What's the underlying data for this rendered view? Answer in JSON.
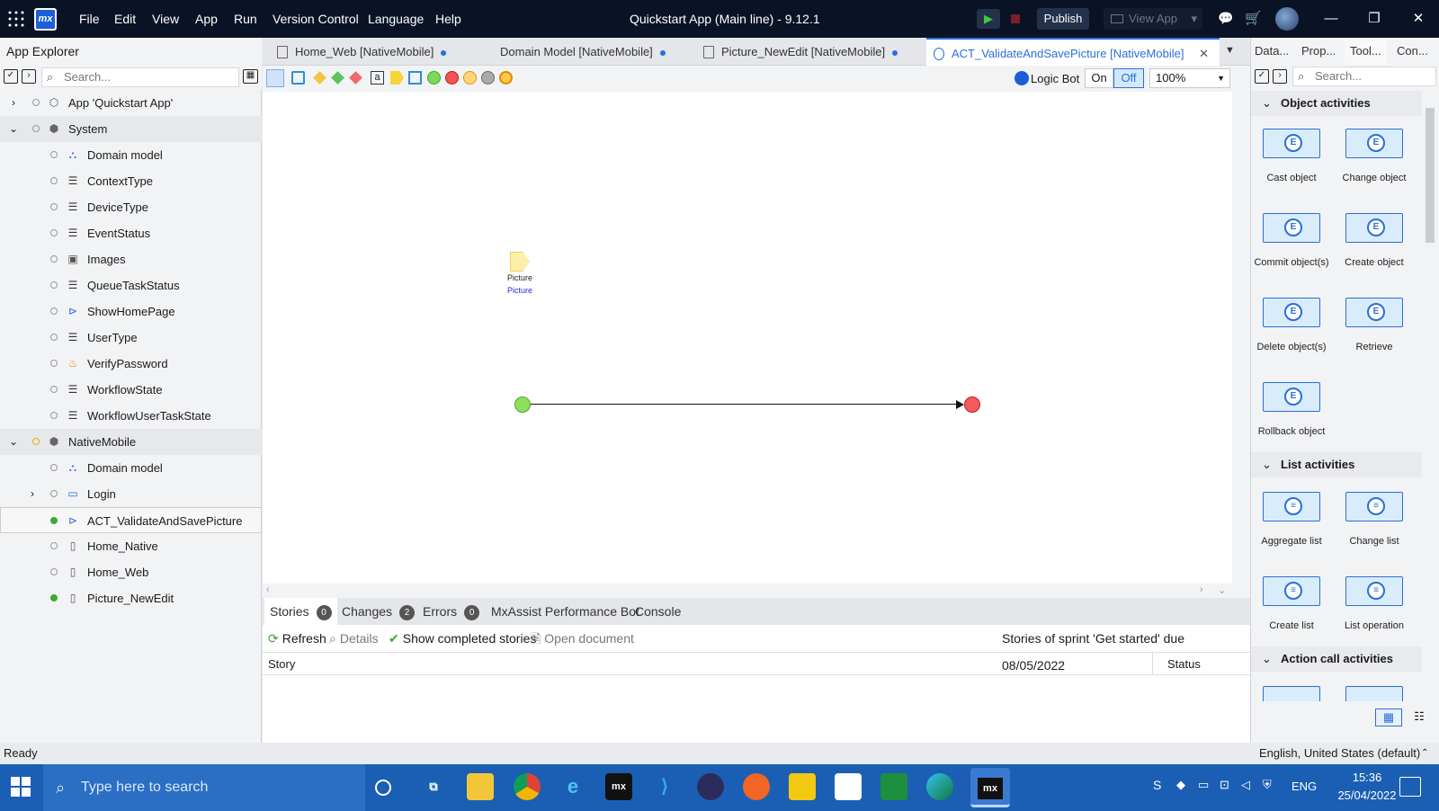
{
  "titlebar": {
    "logo_text": "mx",
    "menus": [
      "File",
      "Edit",
      "View",
      "App",
      "Run",
      "Version Control",
      "Language",
      "Help"
    ],
    "title": "Quickstart App (Main line)  -  9.12.1",
    "publish_label": "Publish",
    "view_app_label": "View App"
  },
  "explorer": {
    "title": "App Explorer",
    "search_placeholder": "Search...",
    "items": [
      {
        "label": "App 'Quickstart App'",
        "icon": "box-icon"
      },
      {
        "label": "System",
        "icon": "module-icon"
      },
      {
        "label": "Domain model",
        "icon": "domain-model-icon"
      },
      {
        "label": "ContextType",
        "icon": "enumeration-icon"
      },
      {
        "label": "DeviceType",
        "icon": "enumeration-icon"
      },
      {
        "label": "EventStatus",
        "icon": "enumeration-icon"
      },
      {
        "label": "Images",
        "icon": "image-collection-icon"
      },
      {
        "label": "QueueTaskStatus",
        "icon": "enumeration-icon"
      },
      {
        "label": "ShowHomePage",
        "icon": "microflow-icon"
      },
      {
        "label": "UserType",
        "icon": "enumeration-icon"
      },
      {
        "label": "VerifyPassword",
        "icon": "java-action-icon"
      },
      {
        "label": "WorkflowState",
        "icon": "enumeration-icon"
      },
      {
        "label": "WorkflowUserTaskState",
        "icon": "enumeration-icon"
      },
      {
        "label": "NativeMobile",
        "icon": "module-icon"
      },
      {
        "label": "Domain model",
        "icon": "domain-model-icon"
      },
      {
        "label": "Login",
        "icon": "folder-icon"
      },
      {
        "label": "ACT_ValidateAndSavePicture",
        "icon": "microflow-icon"
      },
      {
        "label": "Home_Native",
        "icon": "native-page-icon"
      },
      {
        "label": "Home_Web",
        "icon": "page-icon"
      },
      {
        "label": "Picture_NewEdit",
        "icon": "page-icon"
      }
    ]
  },
  "tabs": [
    {
      "label": "Home_Web [NativeMobile]"
    },
    {
      "label": "Domain Model [NativeMobile]"
    },
    {
      "label": "Picture_NewEdit [NativeMobile]"
    },
    {
      "label": "ACT_ValidateAndSavePicture [NativeMobile]"
    }
  ],
  "toolstrip": {
    "logic_bot_label": "Logic Bot",
    "on_label": "On",
    "off_label": "Off",
    "zoom": "100%"
  },
  "canvas": {
    "parameter_name": "Picture",
    "parameter_type": "Picture"
  },
  "bottom": {
    "tabs": [
      {
        "label": "Stories",
        "count": "0"
      },
      {
        "label": "Changes",
        "count": "2"
      },
      {
        "label": "Errors",
        "count": "0"
      },
      {
        "label": "MxAssist Performance Bot",
        "count": ""
      },
      {
        "label": "Console",
        "count": ""
      }
    ],
    "refresh_label": "Refresh",
    "details_label": "Details",
    "show_completed_label": "Show completed stories",
    "open_document_label": "Open document",
    "sprint_text": "Stories of sprint 'Get started' due 08/05/2022",
    "col_story": "Story",
    "col_status": "Status"
  },
  "right": {
    "tabs": [
      "Data...",
      "Prop...",
      "Tool...",
      "Con..."
    ],
    "search_placeholder": "Search...",
    "sections": [
      {
        "title": "Object activities",
        "items": [
          "Cast object",
          "Change object",
          "Commit object(s)",
          "Create object",
          "Delete object(s)",
          "Retrieve",
          "Rollback object"
        ]
      },
      {
        "title": "List activities",
        "items": [
          "Aggregate list",
          "Change list",
          "Create list",
          "List operation"
        ]
      },
      {
        "title": "Action call activities",
        "items": [
          "",
          ""
        ]
      }
    ]
  },
  "status": {
    "left": "Ready",
    "right": "English, United States (default)"
  },
  "taskbar": {
    "search_placeholder": "Type here to search",
    "lang": "ENG",
    "time": "15:36",
    "date": "25/04/2022"
  }
}
